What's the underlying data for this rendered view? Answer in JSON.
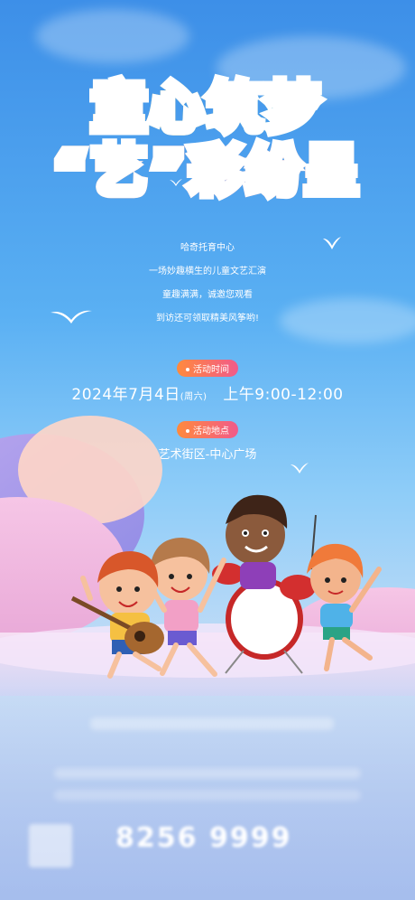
{
  "title": {
    "line1": "童心筑梦",
    "line2": "“艺”彩纷呈"
  },
  "intro": {
    "lines": [
      "哈奇托育中心",
      "一场妙趣横生的儿童文艺汇演",
      "童趣满满，诚邀您观看",
      "到访还可领取精美风筝哟!"
    ]
  },
  "event": {
    "time_label": "活动时间",
    "date": "2024年7月4日",
    "weekday": "(周六)",
    "hours": "上午9:00-12:00",
    "place_label": "活动地点",
    "place": "艺术街区-中心广场"
  },
  "footer": {
    "phone": "8256 9999"
  },
  "colors": {
    "sky_top": "#3d8fe8",
    "sky_bottom": "#b9c9ef",
    "badge_start": "#ff8a3d",
    "badge_end": "#f15a8a"
  }
}
